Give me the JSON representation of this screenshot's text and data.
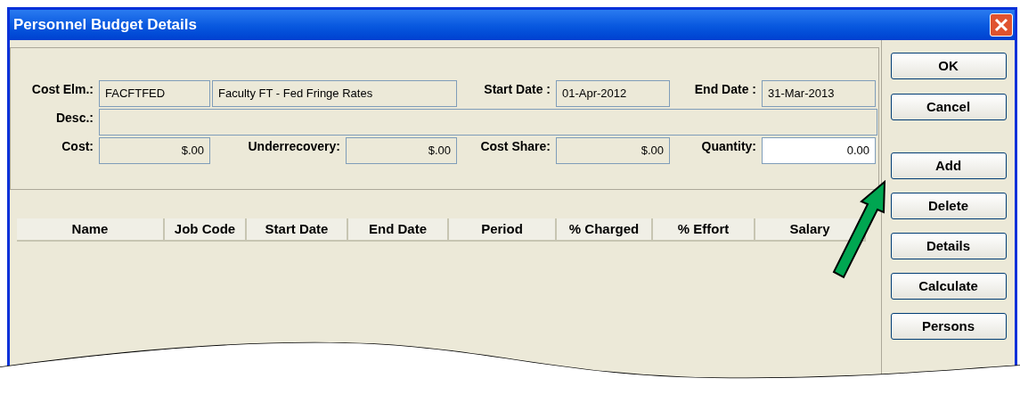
{
  "window": {
    "title": "Personnel Budget Details"
  },
  "form": {
    "cost_elm": {
      "label": "Cost Elm.:",
      "code": "FACFTFED",
      "description": "Faculty FT - Fed Fringe Rates"
    },
    "start_date": {
      "label": "Start Date :",
      "value": "01-Apr-2012"
    },
    "end_date": {
      "label": "End Date :",
      "value": "31-Mar-2013"
    },
    "desc": {
      "label": "Desc.:"
    },
    "cost": {
      "label": "Cost:",
      "value": "$.00"
    },
    "underrecovery": {
      "label": "Underrecovery:",
      "value": "$.00"
    },
    "cost_share": {
      "label": "Cost Share:",
      "value": "$.00"
    },
    "quantity": {
      "label": "Quantity:",
      "value": "0.00"
    }
  },
  "table": {
    "columns": [
      "Name",
      "Job Code",
      "Start Date",
      "End Date",
      "Period",
      "% Charged",
      "% Effort",
      "Salary"
    ]
  },
  "buttons": [
    "OK",
    "Cancel",
    "Add",
    "Delete",
    "Details",
    "Calculate",
    "Persons"
  ]
}
